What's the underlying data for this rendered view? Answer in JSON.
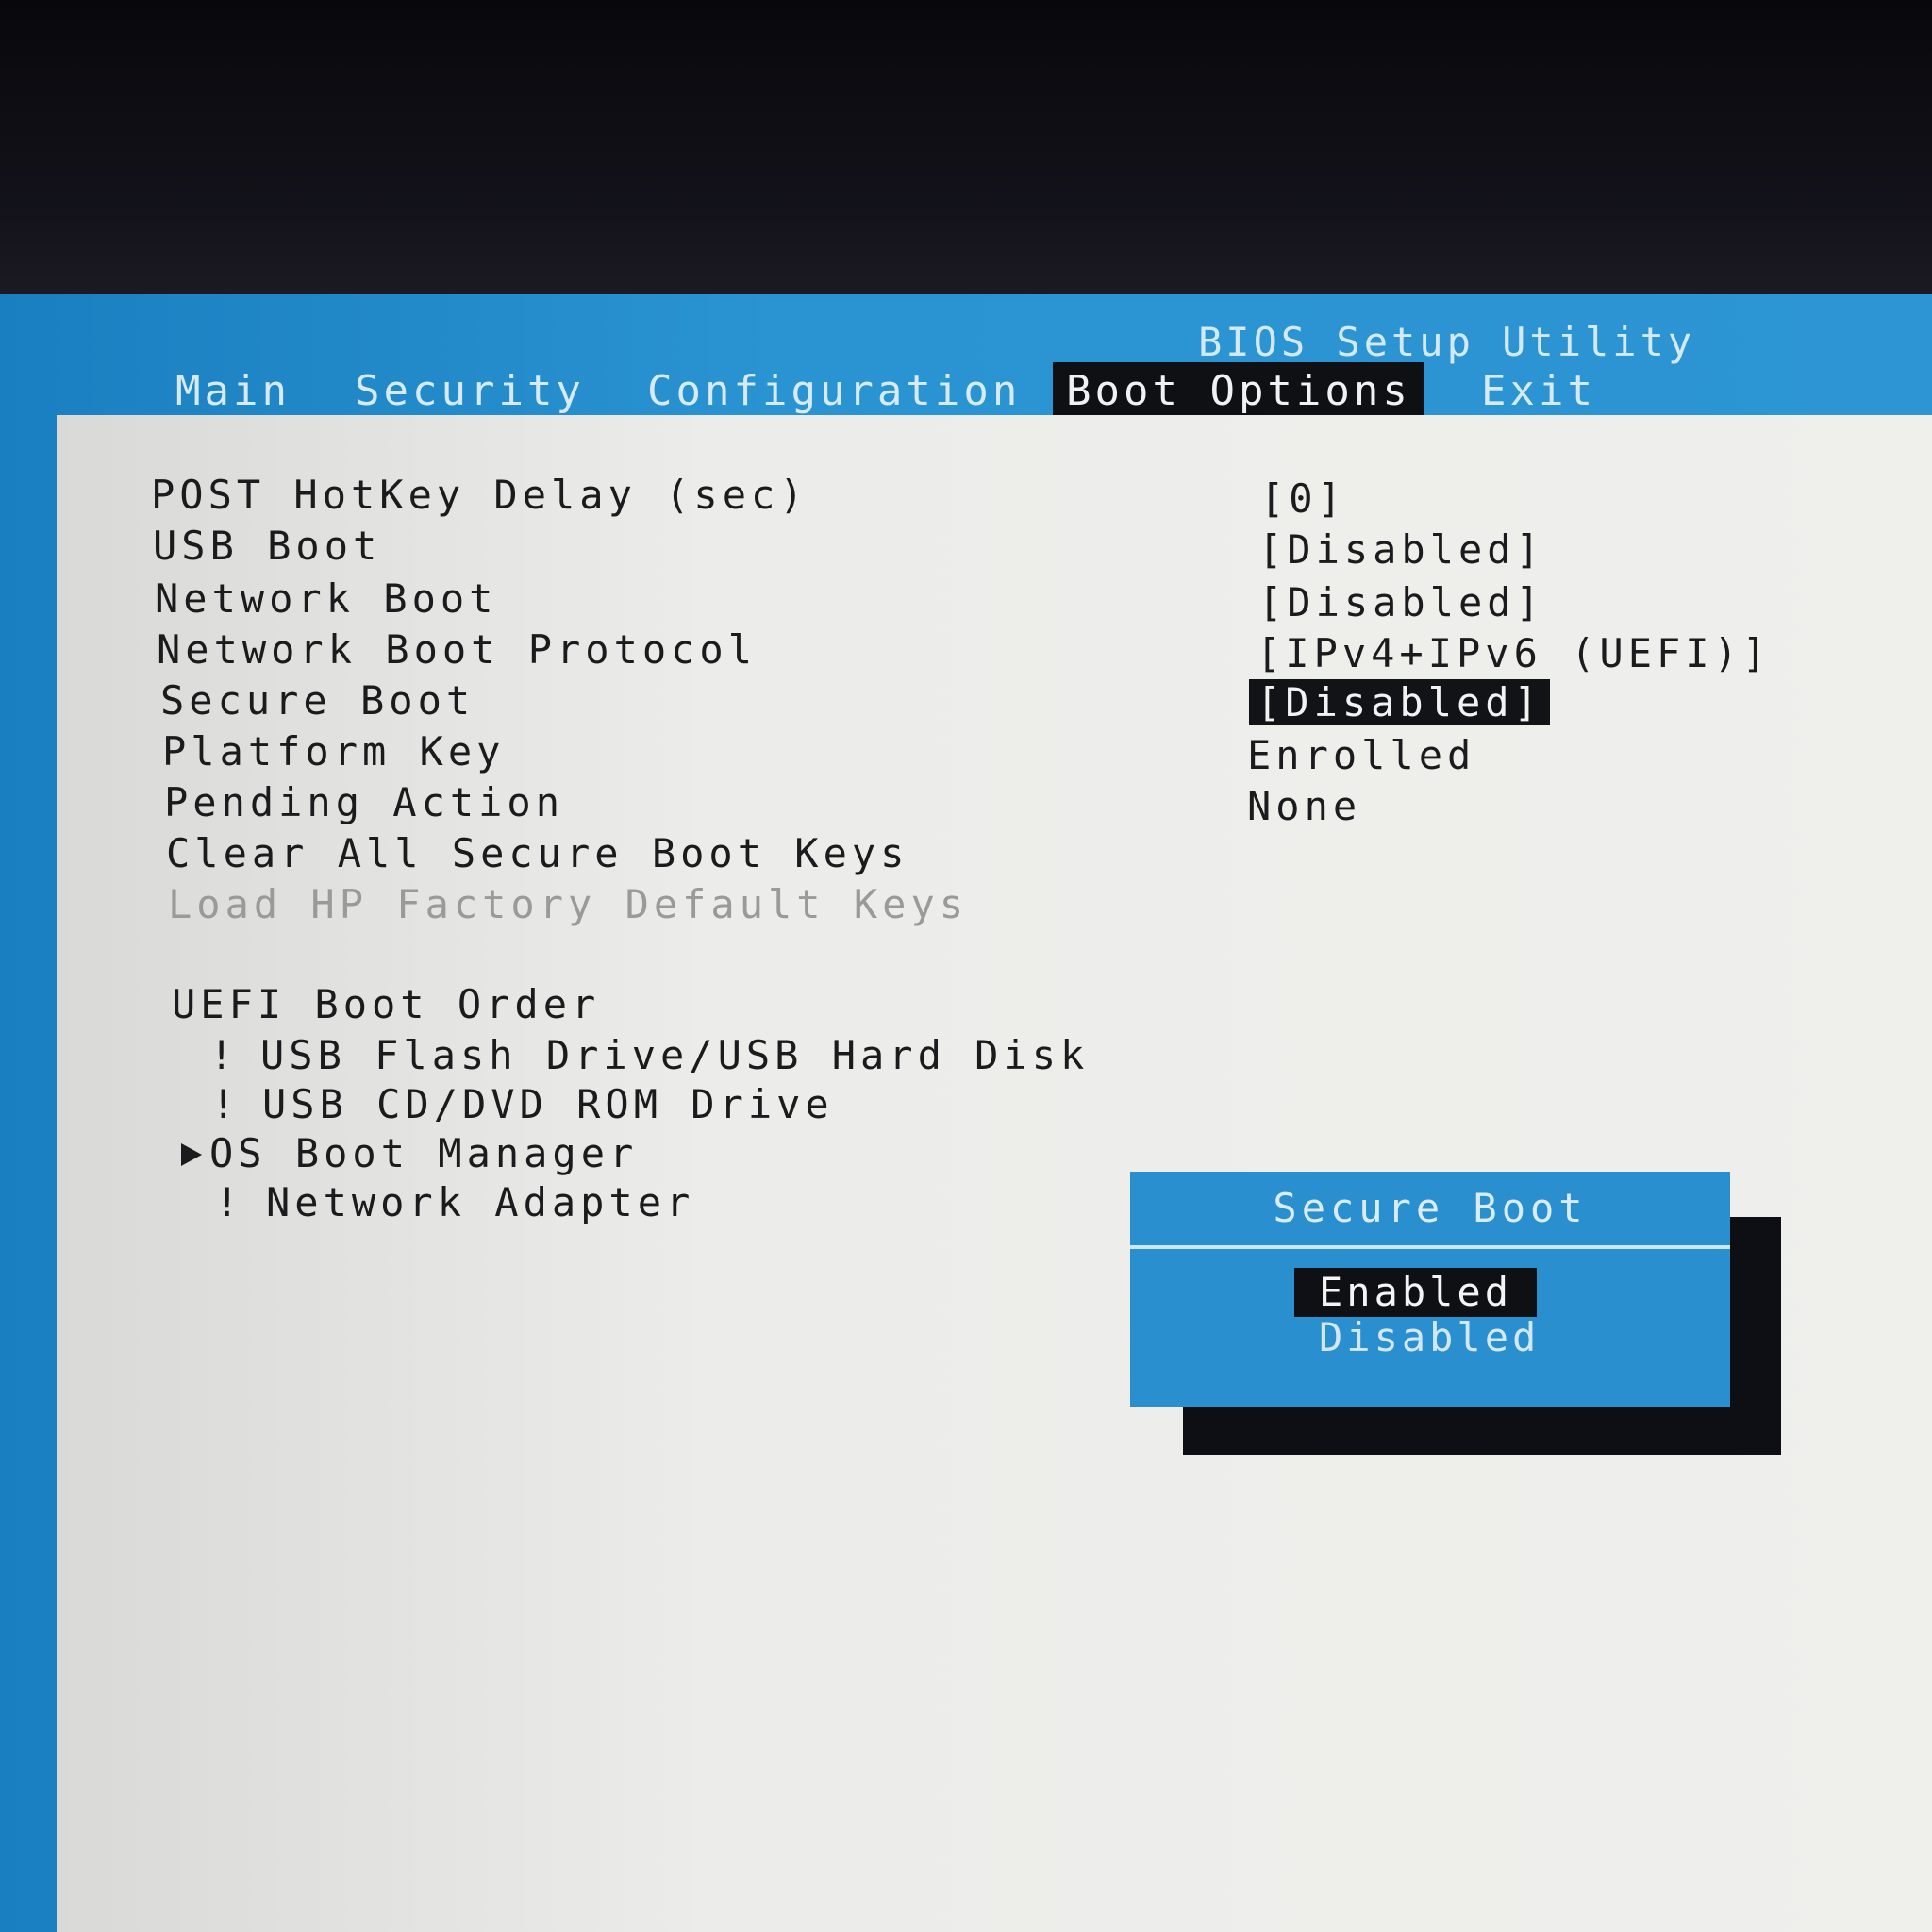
{
  "header": {
    "title": "BIOS Setup Utility",
    "tabs": [
      {
        "label": "Main",
        "active": false
      },
      {
        "label": "Security",
        "active": false
      },
      {
        "label": "Configuration",
        "active": false
      },
      {
        "label": "Boot Options",
        "active": true
      },
      {
        "label": "Exit",
        "active": false
      }
    ]
  },
  "settings": [
    {
      "label": "POST HotKey Delay (sec)",
      "value": "[0]"
    },
    {
      "label": "USB Boot",
      "value": "[Disabled]"
    },
    {
      "label": "Network Boot",
      "value": "[Disabled]"
    },
    {
      "label": "Network Boot Protocol",
      "value": "[IPv4+IPv6 (UEFI)]"
    },
    {
      "label": "Secure Boot",
      "value": "[Disabled]",
      "selected": true
    },
    {
      "label": "Platform Key",
      "value": "Enrolled"
    },
    {
      "label": "Pending Action",
      "value": "None"
    },
    {
      "label": "Clear All Secure Boot Keys",
      "value": ""
    },
    {
      "label": "Load HP Factory Default Keys",
      "value": "",
      "disabled": true
    }
  ],
  "boot_order": {
    "heading": "UEFI Boot Order",
    "items": [
      {
        "marker": "!",
        "label": "USB Flash Drive/USB Hard Disk"
      },
      {
        "marker": "!",
        "label": "USB CD/DVD ROM Drive"
      },
      {
        "marker": "arrow",
        "label": "OS Boot Manager"
      },
      {
        "marker": "!",
        "label": "Network Adapter"
      }
    ]
  },
  "popup": {
    "title": "Secure Boot",
    "options": [
      {
        "label": "Enabled",
        "highlighted": true
      },
      {
        "label": "Disabled",
        "highlighted": false
      }
    ]
  },
  "colors": {
    "frame_blue": "#2a93d1",
    "panel_bg": "#efefec",
    "highlight_bg": "#121317"
  }
}
